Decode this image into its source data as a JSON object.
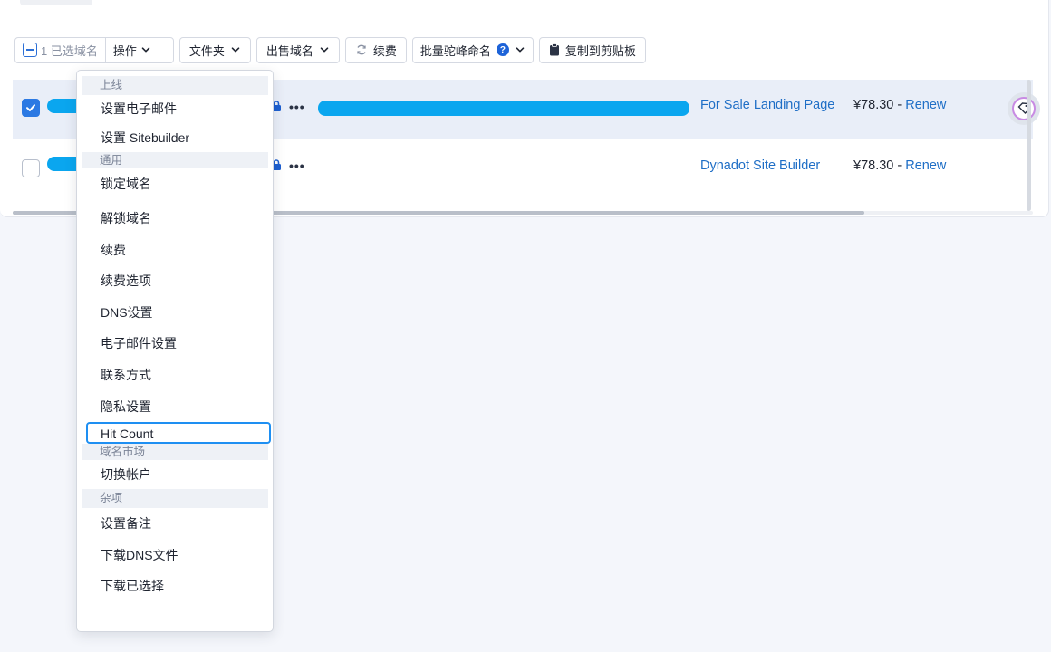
{
  "toolbar": {
    "selected_count": "1 已选域名",
    "actions_label": "操作",
    "folder_label": "文件夹",
    "sell_label": "出售域名",
    "renew_label": "续费",
    "bulk_camel_label": "批量驼峰命名",
    "bulk_help": "?",
    "copy_label": "复制到剪贴板"
  },
  "rows": [
    {
      "selected": true,
      "site": "For Sale Landing Page",
      "price": "¥78.30",
      "renew": "Renew",
      "dots": "•••"
    },
    {
      "selected": false,
      "site": "Dynadot Site Builder",
      "price": "¥78.30",
      "renew": "Renew",
      "dots": "•••"
    }
  ],
  "price_separator": " - ",
  "menu": {
    "section_online": "上线",
    "set_email": "设置电子邮件",
    "set_sitebuilder": "设置 Sitebuilder",
    "section_general": "通用",
    "lock_domain": "锁定域名",
    "unlock_domain": "解锁域名",
    "renew": "续费",
    "renew_options": "续费选项",
    "dns_settings": "DNS设置",
    "email_settings": "电子邮件设置",
    "contacts": "联系方式",
    "privacy_settings": "隐私设置",
    "hit_count": "Hit Count",
    "section_market": "域名市场",
    "switch_account": "切换帐户",
    "section_misc": "杂项",
    "set_note": "设置备注",
    "download_dns": "下载DNS文件",
    "download_selected": "下载已选择"
  },
  "colors": {
    "accent": "#2b79e3",
    "link": "#1e6ec6",
    "pill": "#0aa6ef",
    "focus_ring": "#1e8ff2"
  }
}
